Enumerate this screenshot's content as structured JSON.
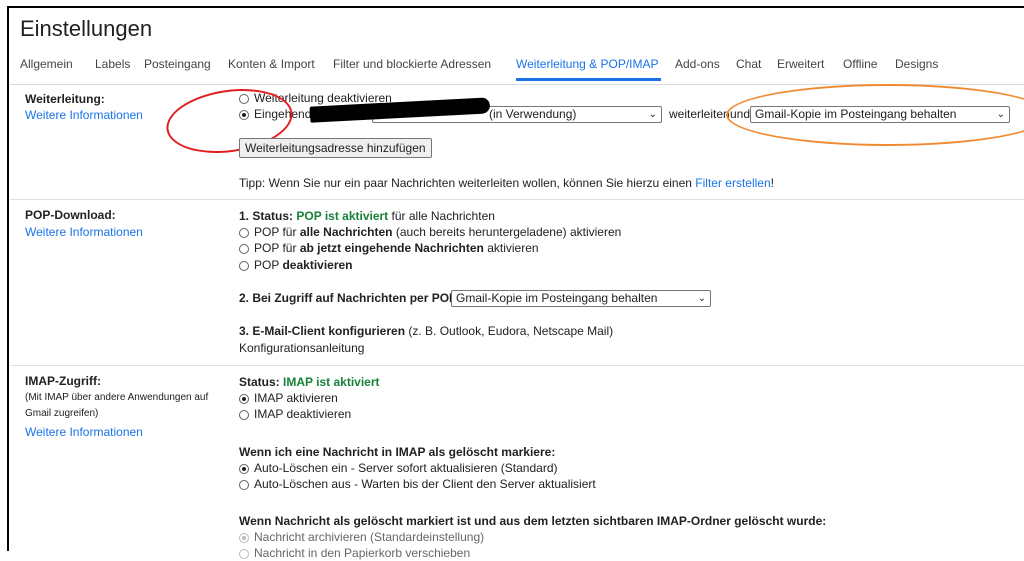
{
  "page": {
    "title": "Einstellungen"
  },
  "tabs": [
    {
      "label": "Allgemein"
    },
    {
      "label": "Labels"
    },
    {
      "label": "Posteingang"
    },
    {
      "label": "Konten & Import"
    },
    {
      "label": "Filter und blockierte Adressen"
    },
    {
      "label": "Weiterleitung & POP/IMAP",
      "active": true
    },
    {
      "label": "Add-ons"
    },
    {
      "label": "Chat"
    },
    {
      "label": "Erweitert"
    },
    {
      "label": "Offline"
    },
    {
      "label": "Designs"
    }
  ],
  "forwarding": {
    "label": "Weiterleitung:",
    "more_info": "Weitere Informationen",
    "opt_disable": "Weiterleitung deaktivieren",
    "opt_forward_prefix": "Eingehende E-Mails an",
    "address_value": "(in Verwendung)",
    "forward_word": "weiterleiten",
    "and_word": "und",
    "action_value": "Gmail-Kopie im Posteingang behalten",
    "add_button": "Weiterleitungsadresse hinzufügen",
    "tip_prefix": "Tipp: Wenn Sie nur ein paar Nachrichten weiterleiten wollen, können Sie hierzu einen",
    "tip_link": "Filter erstellen",
    "tip_suffix": "!"
  },
  "pop": {
    "label": "POP-Download:",
    "more_info": "Weitere Informationen",
    "status_prefix": "1. Status:",
    "status_value": "POP ist aktiviert",
    "status_suffix": "für alle Nachrichten",
    "opt1_a": "POP für",
    "opt1_b": "alle Nachrichten",
    "opt1_c": "(auch bereits heruntergeladene) aktivieren",
    "opt2_a": "POP für",
    "opt2_b": "ab jetzt eingehende Nachrichten",
    "opt2_c": "aktivieren",
    "opt3_a": "POP",
    "opt3_b": "deaktivieren",
    "access_label": "2. Bei Zugriff auf Nachrichten per POP",
    "access_value": "Gmail-Kopie im Posteingang behalten",
    "client_label": "3. E-Mail-Client konfigurieren",
    "client_note": "(z. B. Outlook, Eudora, Netscape Mail)",
    "client_link": "Konfigurationsanleitung"
  },
  "imap": {
    "label": "IMAP-Zugriff:",
    "note1": "(Mit IMAP über andere Anwendungen auf",
    "note2": "Gmail zugreifen)",
    "more_info": "Weitere Informationen",
    "status_prefix": "Status:",
    "status_value": "IMAP ist aktiviert",
    "opt_enable": "IMAP aktivieren",
    "opt_disable": "IMAP deaktivieren",
    "delete_heading": "Wenn ich eine Nachricht in IMAP als gelöscht markiere:",
    "autodel_on": "Auto-Löschen ein - Server sofort aktualisieren (Standard)",
    "autodel_off": "Auto-Löschen aus - Warten bis der Client den Server aktualisiert",
    "expunge_heading": "Wenn Nachricht als gelöscht markiert ist und aus dem letzten sichtbaren IMAP-Ordner gelöscht wurde:",
    "expunge_archive": "Nachricht archivieren (Standardeinstellung)",
    "expunge_trash": "Nachricht in den Papierkorb verschieben"
  },
  "colors": {
    "accent": "#1a73e8",
    "status_green": "#188038",
    "annot_red": "#e02020",
    "annot_orange": "#f08a30"
  }
}
